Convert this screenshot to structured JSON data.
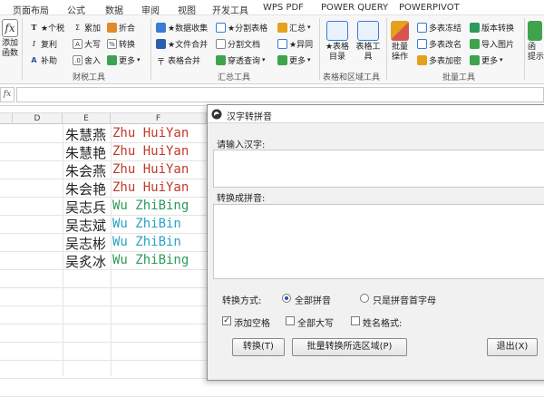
{
  "menu": {
    "tabs": [
      "页面布局",
      "公式",
      "数据",
      "审阅",
      "视图",
      "开发工具",
      "WPS PDF",
      "POWER QUERY",
      "POWERPIVOT"
    ]
  },
  "ribbon": {
    "add_function": {
      "line1": "添加",
      "line2": "函数"
    },
    "finance": {
      "items": [
        "★个税",
        "复利",
        "补助",
        "累加",
        "大写",
        "舍入",
        "折合",
        "转换",
        "更多"
      ],
      "group_label": "财税工具"
    },
    "summary": {
      "items": [
        "★数据收集",
        "★文件合并",
        "表格合并",
        "★分割表格",
        "分割文档",
        "穿透查询",
        "汇总",
        "★异同",
        "更多"
      ],
      "group_label": "汇总工具"
    },
    "table_area": {
      "items": [
        {
          "line1": "★表格",
          "line2": "目录"
        },
        {
          "line1": "表格工",
          "line2": "具"
        }
      ],
      "group_label": "表格和区域工具"
    },
    "batch": {
      "big": {
        "line1": "批量",
        "line2": "操作"
      },
      "items": [
        "多表冻结",
        "多表改名",
        "多表加密",
        "版本转换",
        "导入图片",
        "更多"
      ],
      "group_label": "批量工具"
    },
    "extra": {
      "line1": "函",
      "line2": "提示"
    }
  },
  "formula_bar": {
    "fx": "fx",
    "value": ""
  },
  "sheet": {
    "columns": [
      "D",
      "E",
      "F"
    ],
    "rows": [
      {
        "name": "朱慧燕",
        "pinyin": "Zhu HuiYan",
        "color": "#c0392b"
      },
      {
        "name": "朱慧艳",
        "pinyin": "Zhu HuiYan",
        "color": "#c0392b"
      },
      {
        "name": "朱会燕",
        "pinyin": "Zhu HuiYan",
        "color": "#c0392b"
      },
      {
        "name": "朱会艳",
        "pinyin": "Zhu HuiYan",
        "color": "#c0392b"
      },
      {
        "name": "吴志兵",
        "pinyin": "Wu ZhiBing",
        "color": "#2e9a5a"
      },
      {
        "name": "吴志斌",
        "pinyin": "Wu ZhiBin",
        "color": "#2aa3c4"
      },
      {
        "name": "吴志彬",
        "pinyin": "Wu ZhiBin",
        "color": "#2aa3c4"
      },
      {
        "name": "吴炙冰",
        "pinyin": "Wu ZhiBing",
        "color": "#2e9a5a"
      }
    ]
  },
  "dialog": {
    "title": "汉字转拼音",
    "input_label": "请输入汉字:",
    "input_value": "",
    "output_label": "转换成拼音:",
    "output_value": "",
    "mode_label": "转换方式:",
    "mode_options": [
      "全部拼音",
      "只是拼音首字母"
    ],
    "mode_selected": "全部拼音",
    "checkboxes": [
      {
        "label": "添加空格",
        "checked": true
      },
      {
        "label": "全部大写",
        "checked": false
      },
      {
        "label": "姓名格式:",
        "checked": false
      }
    ],
    "buttons": {
      "convert": "转换(T)",
      "batch": "批量转换所选区域(P)",
      "exit": "退出(X)"
    }
  },
  "colors": {
    "pinyin_red": "#c0392b",
    "pinyin_green": "#2e9a5a",
    "pinyin_cyan": "#2aa3c4"
  }
}
